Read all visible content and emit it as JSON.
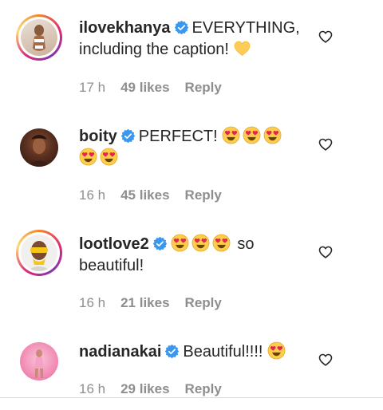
{
  "comments": [
    {
      "username": "ilovekhanya",
      "line1": "EVERYTHING,",
      "line2": "including the caption!",
      "emoji_line1": [],
      "emoji_line2": [
        "yellow-heart-emoji"
      ],
      "time": "17 h",
      "likes": "49 likes",
      "reply": "Reply",
      "ring": true
    },
    {
      "username": "boity",
      "line1": "PERFECT!",
      "line2": "",
      "emoji_line1": [
        "heart-eyes-emoji",
        "heart-eyes-emoji",
        "heart-eyes-emoji"
      ],
      "emoji_line2": [
        "heart-eyes-emoji",
        "heart-eyes-emoji"
      ],
      "time": "16 h",
      "likes": "45 likes",
      "reply": "Reply",
      "ring": false
    },
    {
      "username": "lootlove2",
      "line1": "so",
      "line2": "beautiful!",
      "emoji_line1": [
        "heart-eyes-emoji",
        "heart-eyes-emoji",
        "heart-eyes-emoji"
      ],
      "time": "16 h",
      "likes": "21 likes",
      "reply": "Reply",
      "ring": true
    },
    {
      "username": "nadianakai",
      "line1": "Beautiful!!!!",
      "emoji_line1": [
        "heart-eyes-emoji"
      ],
      "time": "16 h",
      "likes": "29 likes",
      "reply": "Reply",
      "ring": false
    }
  ],
  "colors": {
    "verified": "#3897f0",
    "meta": "#8e8e8e",
    "text": "#262626"
  }
}
